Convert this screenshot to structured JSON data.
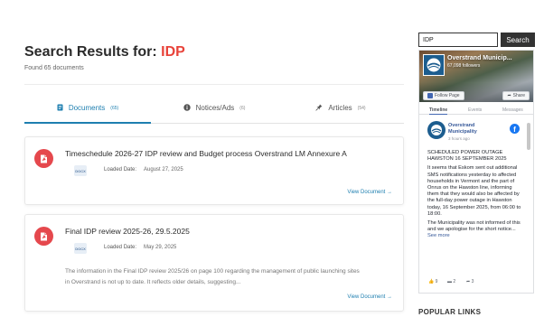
{
  "search_header": {
    "prefix": "Search Results for: ",
    "term": "IDP",
    "found": "Found 65 documents"
  },
  "tabs": [
    {
      "label": "Documents",
      "count": "(65)",
      "icon": "document-icon",
      "active": true
    },
    {
      "label": "Notices/Ads",
      "count": "(6)",
      "icon": "info-circle-icon",
      "active": false
    },
    {
      "label": "Articles",
      "count": "(54)",
      "icon": "pin-icon",
      "active": false
    }
  ],
  "results": [
    {
      "title": "Timeschedule 2026-27 IDP review and Budget process Overstrand LM Annexure A",
      "file_type": "DOCX",
      "loaded_label": "Loaded Date:",
      "loaded_date": "August 27, 2025",
      "description": "",
      "link": "View Document →"
    },
    {
      "title": "Final IDP review 2025-26, 29.5.2025",
      "file_type": "DOCX",
      "loaded_label": "Loaded Date:",
      "loaded_date": "May 29, 2025",
      "description": "The information in the Final IDP review 2025/26 on page 100 regarding the management of public launching sites in Overstrand is not up to date. It reflects older details, suggesting...",
      "link": "View Document →"
    }
  ],
  "sidebar": {
    "search": {
      "value": "IDP",
      "button": "Search"
    },
    "facebook": {
      "page_name": "Overstrand Municip...",
      "likes": "67,098 followers",
      "follow": "Follow Page",
      "share": "Share",
      "tabs": [
        "Timeline",
        "Events",
        "Messages"
      ],
      "post": {
        "author": "Overstrand Municipality",
        "time": "3 hours ago",
        "paragraphs": [
          "SCHEDULED POWER OUTAGE HAWSTON 16 SEPTEMBER 2025",
          "It seems that Eskom sent out additional SMS notifications yesterday to affected households in Vermont and the part of Onrus on the Hawston line, informing them that they would also be affected by the full-day power outage in Hawston today, 16 September 2025, from 06:00 to 18:00.",
          "The Municipality was not informed of this and we apologise for the short notice..."
        ],
        "see_more": "See more",
        "reactions": "9",
        "comments": "2",
        "shares": "3"
      }
    },
    "popular_links": "POPULAR LINKS"
  },
  "colors": {
    "accent_red": "#e8433a",
    "link_blue": "#1e7fb0",
    "pdf_red": "#e5484d",
    "facebook_blue": "#1877f2"
  }
}
